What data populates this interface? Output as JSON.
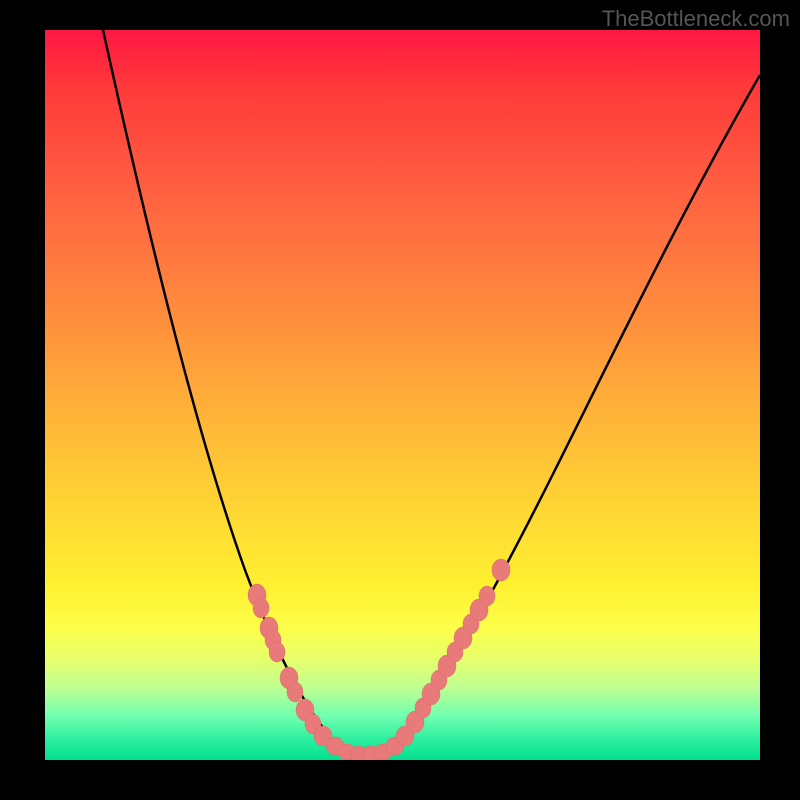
{
  "watermark": "TheBottleneck.com",
  "chart_data": {
    "type": "line",
    "title": "",
    "xlabel": "",
    "ylabel": "",
    "xlim": [
      0,
      100
    ],
    "ylim": [
      0,
      100
    ],
    "background_gradient": {
      "direction": "vertical",
      "stops": [
        {
          "pos": 0,
          "color": "#ff1744"
        },
        {
          "pos": 50,
          "color": "#ffc236"
        },
        {
          "pos": 80,
          "color": "#fcff4a"
        },
        {
          "pos": 100,
          "color": "#00e090"
        }
      ]
    },
    "series": [
      {
        "name": "bottleneck-curve",
        "color": "#000000",
        "x": [
          8,
          15,
          22,
          28,
          34,
          40,
          45,
          50,
          56,
          64,
          72,
          80,
          90,
          100
        ],
        "y": [
          100,
          78,
          58,
          42,
          28,
          14,
          4,
          1,
          6,
          20,
          38,
          55,
          76,
          94
        ]
      },
      {
        "name": "highlighted-points",
        "color": "#e97a7a",
        "marker": "circle",
        "x": [
          30,
          31,
          32,
          33,
          34,
          36,
          37,
          38,
          39,
          40,
          41,
          42,
          43,
          44,
          45,
          49,
          50,
          52,
          53,
          54,
          55,
          56,
          57,
          58,
          59,
          60,
          61,
          64
        ],
        "y": [
          23,
          21,
          18,
          17,
          15,
          12,
          10,
          8,
          6,
          4,
          3,
          2,
          1,
          1,
          1,
          2,
          3,
          5,
          7,
          9,
          11,
          13,
          15,
          17,
          19,
          21,
          23,
          27
        ]
      }
    ],
    "annotations": []
  }
}
